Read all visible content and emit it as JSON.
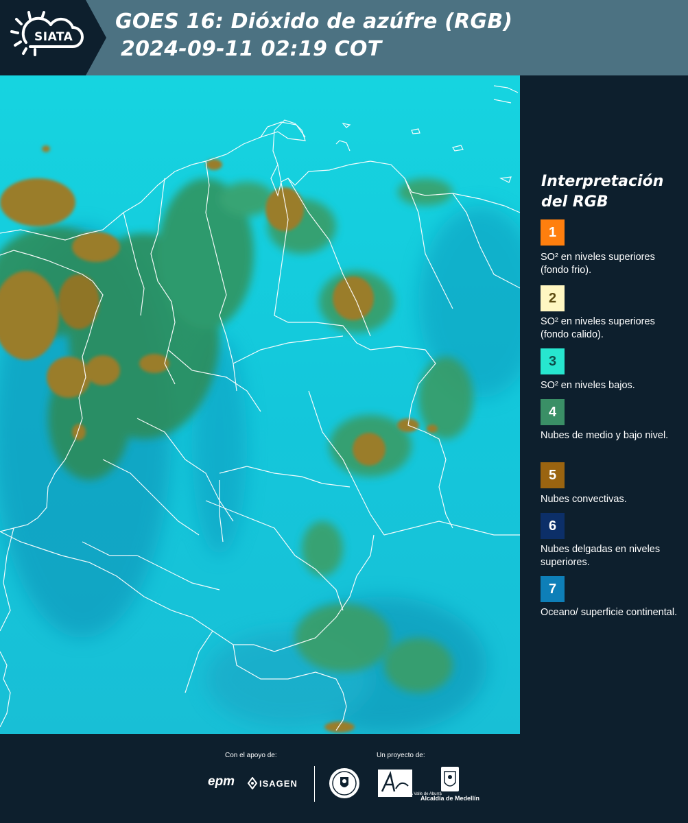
{
  "header": {
    "logo_text": "SIATA",
    "title_line1": "GOES 16: Dióxido de azúfre (RGB)",
    "title_line2": "2024-09-11 02:19 COT"
  },
  "legend": {
    "title": "Interpretación del RGB",
    "items": [
      {
        "number": "1",
        "color": "#ff7f0e",
        "text": "SO² en niveles superiores (fondo frio)."
      },
      {
        "number": "2",
        "color": "#fff7c2",
        "text": "SO² en niveles superiores (fondo calido)."
      },
      {
        "number": "3",
        "color": "#27e6cf",
        "text": "SO² en niveles bajos."
      },
      {
        "number": "4",
        "color": "#3a8f66",
        "text": "Nubes de medio y bajo nivel."
      },
      {
        "number": "5",
        "color": "#9a6410",
        "text": "Nubes convectivas."
      },
      {
        "number": "6",
        "color": "#0c2f68",
        "text": "Nubes delgadas en niveles superiores."
      },
      {
        "number": "7",
        "color": "#0e7fb8",
        "text": "Oceano/ superficie continental."
      }
    ]
  },
  "footer": {
    "support_label": "Con el apoyo de:",
    "project_label": "Un proyecto de:",
    "sponsor1": "epm",
    "sponsor2": "ISAGEN",
    "partner1": "Área Metropolitana",
    "partner1_sub": "METROPOLITANA Valle de Aburrá",
    "partner2": "Alcaldía de Medellín"
  },
  "colors": {
    "background": "#0d1f2d",
    "header": "#4c7282",
    "map_base": "#12c6d9",
    "cloud_green": "#2f8a55",
    "convective": "#9a7d2a"
  }
}
